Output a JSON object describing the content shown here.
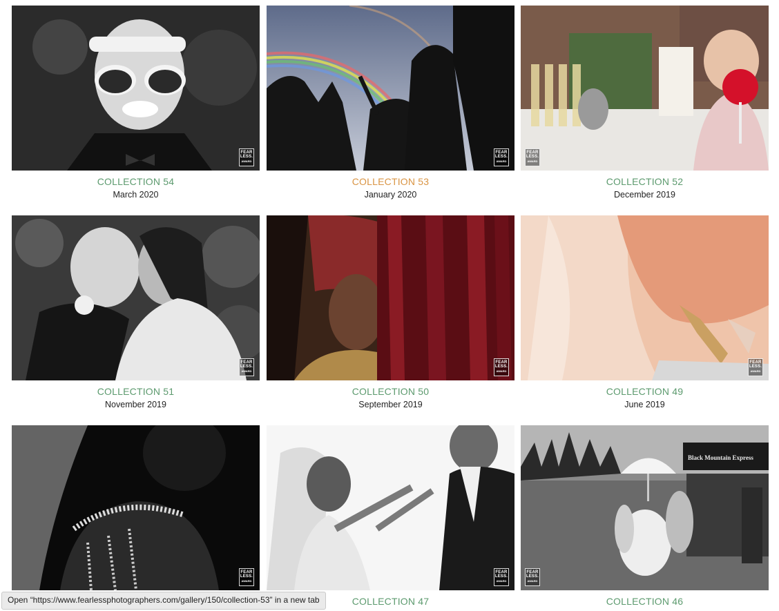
{
  "gallery": {
    "cards": [
      {
        "title": "COLLECTION 54",
        "date": "March 2020",
        "badge": [
          "FEAR",
          "LESS.",
          "AWARD"
        ],
        "image": "boy-with-stacked-sunglasses"
      },
      {
        "title": "COLLECTION 53",
        "date": "January 2020",
        "badge": [
          "FEAR",
          "LESS.",
          "AWARD"
        ],
        "image": "dancing-silhouettes-rainbow"
      },
      {
        "title": "COLLECTION 52",
        "date": "December 2019",
        "badge": [
          "FEAR",
          "LESS.",
          "AWARD"
        ],
        "image": "girl-with-heart-lollipop"
      },
      {
        "title": "COLLECTION 51",
        "date": "November 2019",
        "badge": [
          "FEAR",
          "LESS.",
          "AWARD"
        ],
        "image": "elderly-couple-embrace"
      },
      {
        "title": "COLLECTION 50",
        "date": "September 2019",
        "badge": [
          "FEAR",
          "LESS.",
          "AWARD"
        ],
        "image": "groom-behind-curtain"
      },
      {
        "title": "COLLECTION 49",
        "date": "June 2019",
        "badge": [
          "FEAR",
          "LESS.",
          "AWARD"
        ],
        "image": "flowing-dress-heels"
      },
      {
        "title": "",
        "date": "",
        "badge": [
          "FEAR",
          "LESS.",
          "AWARD"
        ],
        "image": "bride-beaded-back"
      },
      {
        "title": "COLLECTION 47",
        "date": "",
        "badge": [
          "FEAR",
          "LESS.",
          "AWARD"
        ],
        "image": "bride-reaching-father"
      },
      {
        "title": "COLLECTION 46",
        "date": "",
        "badge": [
          "FEAR",
          "LESS.",
          "AWARD"
        ],
        "image": "bride-umbrella-mountain",
        "sign_text": "Black Mountain Express"
      }
    ],
    "hovered_index": 1,
    "colors": {
      "title": "#5c9a6e",
      "title_hover": "#d99443",
      "date": "#222222"
    }
  },
  "status_bar": {
    "text": "Open “https://www.fearlessphotographers.com/gallery/150/collection-53” in a new tab"
  }
}
